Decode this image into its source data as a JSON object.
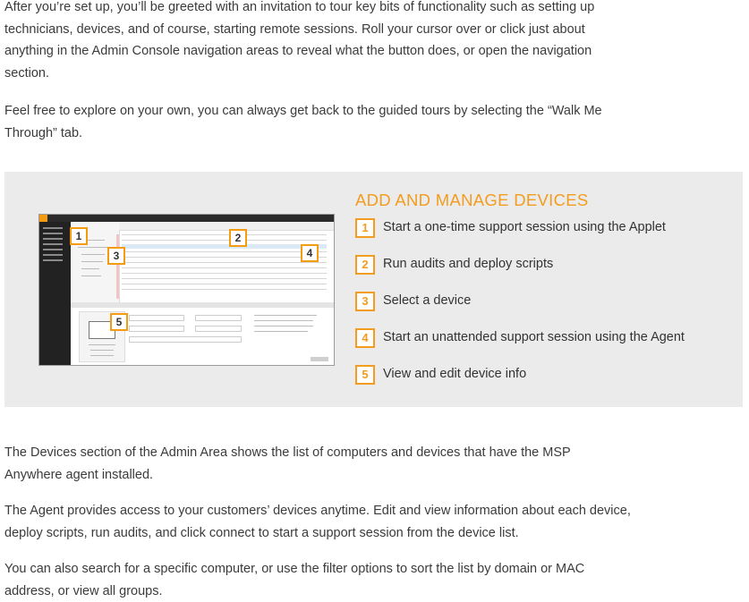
{
  "paragraphs_top": [
    "After you’re set up, you’ll be greeted with an invitation to tour key bits of functionality such as setting up technicians, devices, and of course, starting remote sessions. Roll your cursor over or click just about anything in the Admin Console navigation areas to reveal what the button does, or open the navigation section.",
    "Feel free to explore on your own, you can always get back to the guided tours by selecting the “Walk Me Through” tab."
  ],
  "feature_panel": {
    "title": "ADD AND MANAGE DEVICES",
    "accent_color": "#f39c1f",
    "screenshot_callouts": [
      "1",
      "2",
      "3",
      "4",
      "5"
    ],
    "steps": [
      {
        "number": "1",
        "label": "Start a one-time support session using the Applet"
      },
      {
        "number": "2",
        "label": "Run audits and deploy scripts"
      },
      {
        "number": "3",
        "label": "Select a device"
      },
      {
        "number": "4",
        "label": "Start an unattended support session using the Agent"
      },
      {
        "number": "5",
        "label": "View and edit device info"
      }
    ]
  },
  "paragraphs_bottom": [
    "The Devices section of the Admin Area shows the list of computers and devices that have the MSP Anywhere agent installed.",
    "The Agent provides access to your customers’ devices anytime. Edit and view information about each device, deploy scripts, run audits, and click connect to start a support session from the device list.",
    "You can also search for a specific computer, or use the filter options to sort the list by domain or MAC address, or view all groups."
  ]
}
